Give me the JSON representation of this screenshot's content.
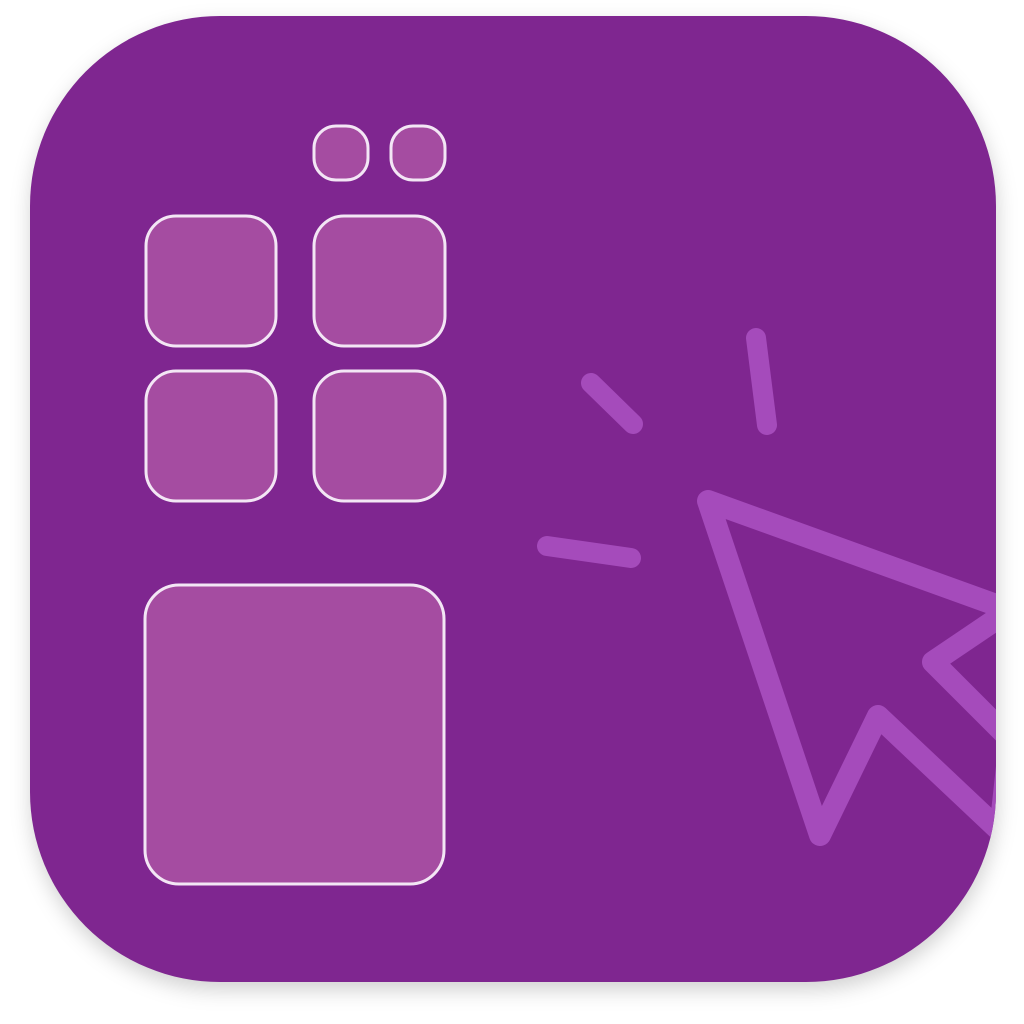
{
  "app_icon": {
    "name": "app-icon",
    "background_color": "#7f2690",
    "tile_fill_color": "#a54ca1",
    "tile_border_color": "#f3e6f5",
    "cursor_color": "#a54bbb",
    "icons": {
      "tile_grid": "tile-grid-icon",
      "cursor": "mouse-cursor-icon",
      "click_rays": "click-rays-icon"
    }
  }
}
